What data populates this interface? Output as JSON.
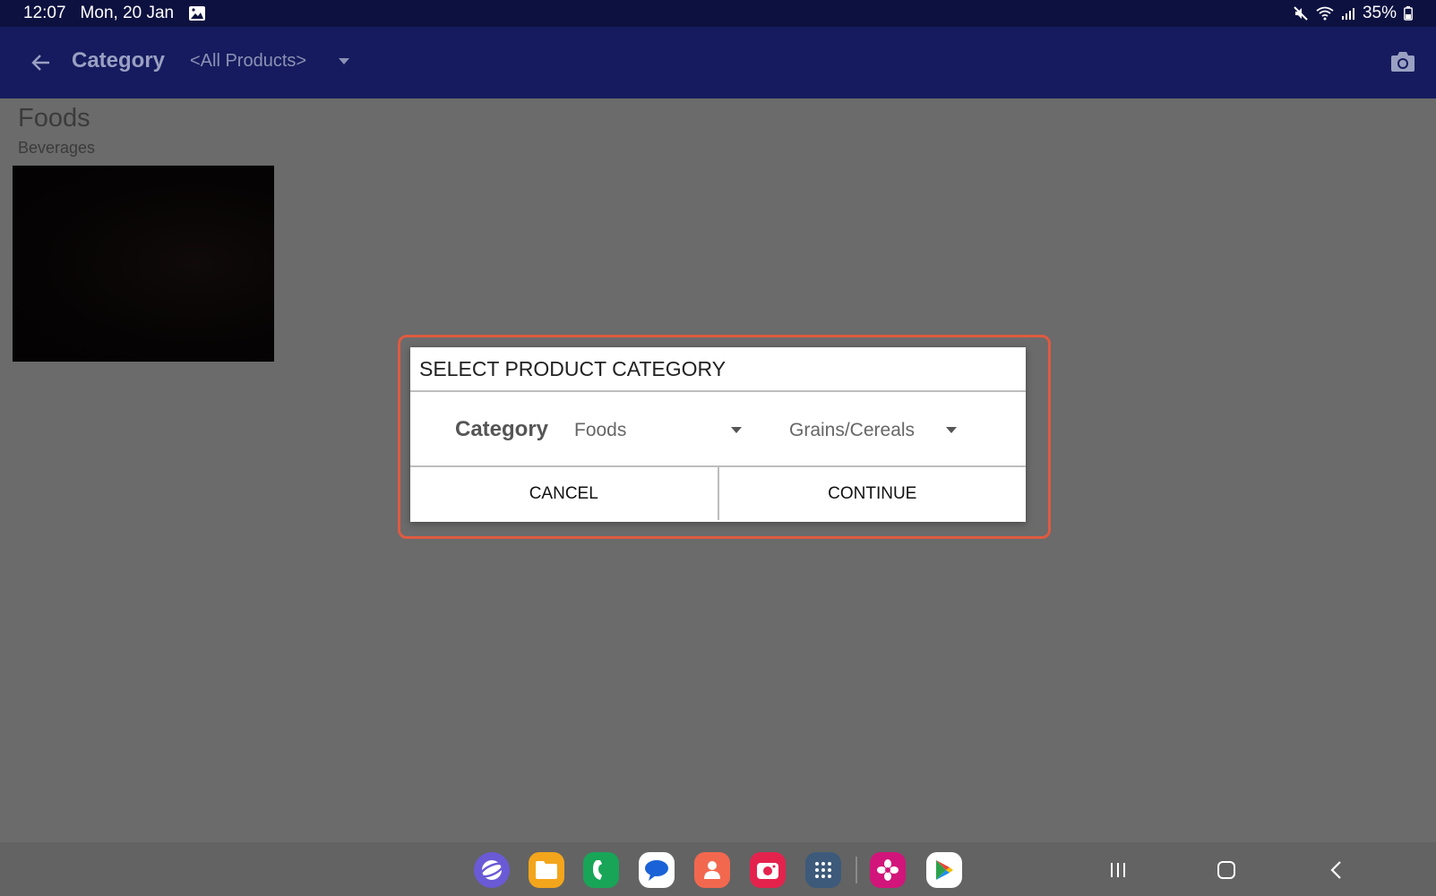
{
  "status_bar": {
    "time": "12:07",
    "date": "Mon, 20 Jan",
    "battery": "35%",
    "icons": [
      "gallery-icon",
      "mute-icon",
      "wifi-icon",
      "signal-icon",
      "battery-icon"
    ]
  },
  "app_bar": {
    "title": "Category",
    "filter_value": "<All Products>",
    "icons": [
      "back-arrow-icon",
      "camera-icon"
    ]
  },
  "content": {
    "heading": "Foods",
    "subheading": "Beverages"
  },
  "dialog": {
    "title": "SELECT PRODUCT CATEGORY",
    "field_label": "Category",
    "category_value": "Foods",
    "subcategory_value": "Grains/Cereals",
    "cancel_label": "CANCEL",
    "continue_label": "CONTINUE",
    "highlight_color": "#e05a40"
  },
  "dock": {
    "apps": [
      "internet-icon",
      "my-files-icon",
      "phone-icon",
      "messages-icon",
      "contacts-icon",
      "camera-app-icon",
      "app-drawer-icon",
      "gallery-app-icon",
      "play-store-icon"
    ]
  },
  "nav": {
    "buttons": [
      "recents-icon",
      "home-icon",
      "back-icon"
    ]
  },
  "colors": {
    "status_bar": "#0d1140",
    "app_bar": "#151b5e",
    "scrim": "#6b6b6b"
  }
}
